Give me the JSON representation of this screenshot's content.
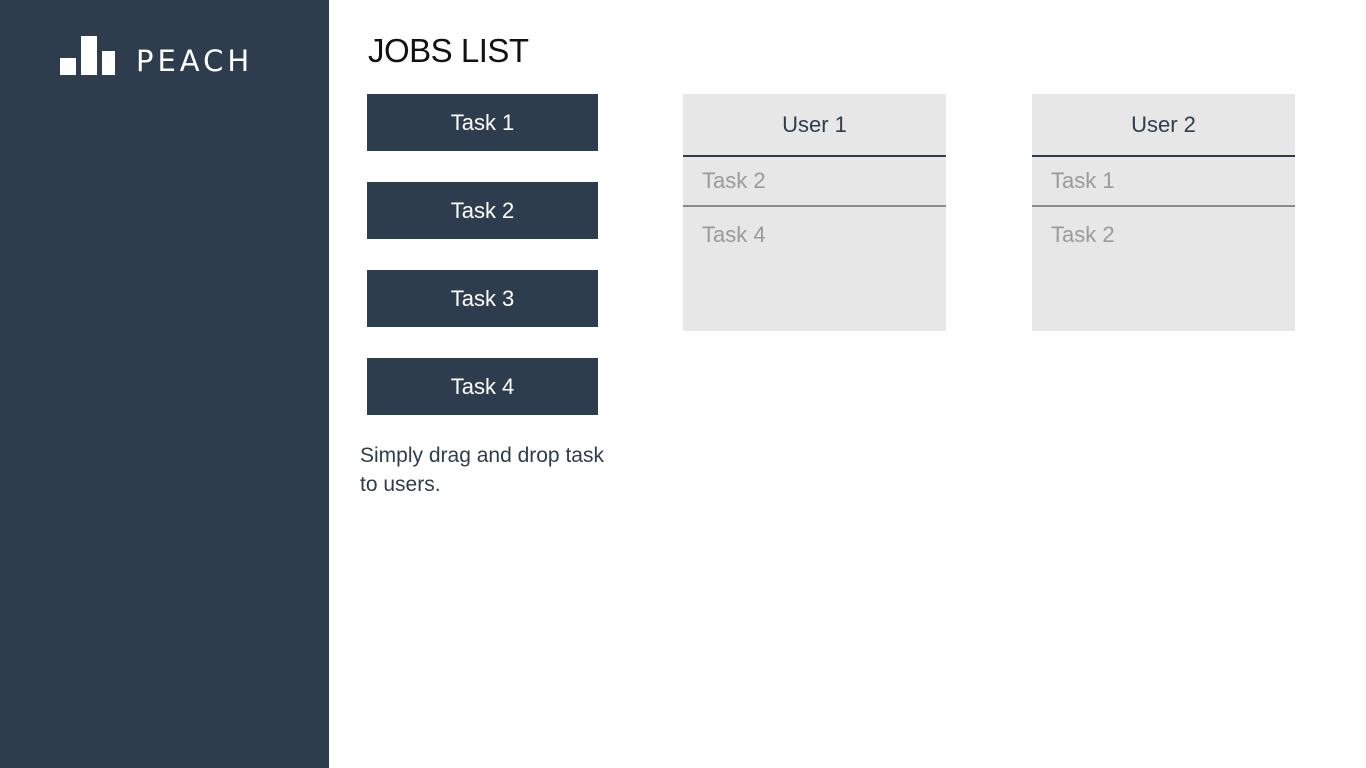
{
  "brand": {
    "name": "PEACH"
  },
  "page": {
    "title": "JOBS LIST"
  },
  "tasks": [
    {
      "label": "Task 1"
    },
    {
      "label": "Task 2"
    },
    {
      "label": "Task 3"
    },
    {
      "label": "Task 4"
    }
  ],
  "hint": "Simply drag and drop task to users.",
  "users": [
    {
      "name": "User 1",
      "tasks": [
        "Task 2",
        "Task 4"
      ]
    },
    {
      "name": "User 2",
      "tasks": [
        "Task 1",
        "Task 2"
      ]
    }
  ],
  "colors": {
    "sidebar": "#2e3d4d",
    "task_button": "#2e3d4d",
    "user_panel": "#e7e7e7",
    "assigned_task_text": "#9a9a9a"
  }
}
